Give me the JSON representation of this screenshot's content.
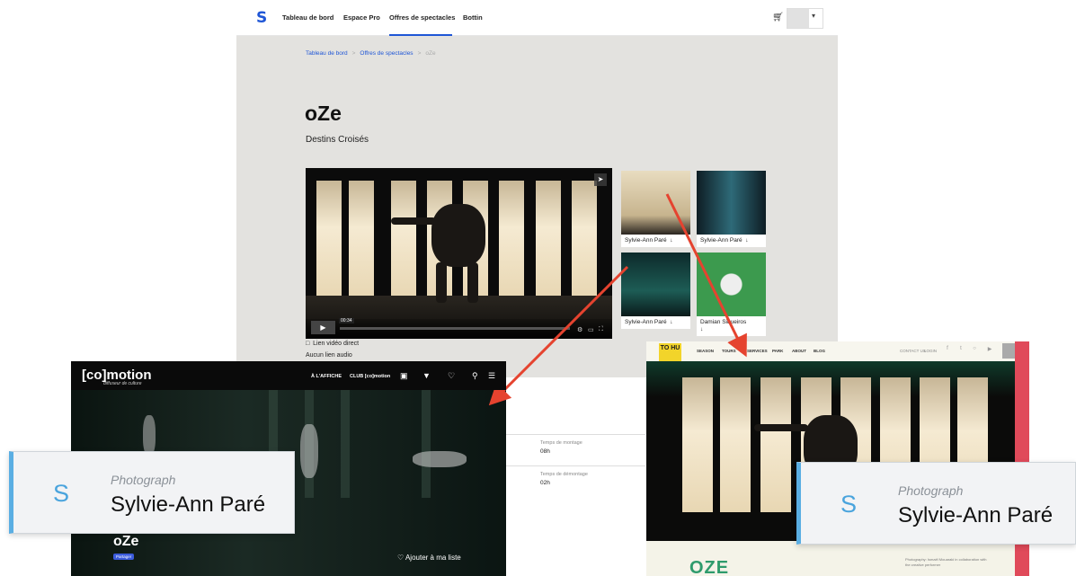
{
  "nav": {
    "logo": "S",
    "items": [
      "Tableau de bord",
      "Espace Pro",
      "Offres de spectacles",
      "Bottin"
    ],
    "active": "Offres de spectacles"
  },
  "breadcrumb": {
    "home": "Tableau de bord",
    "section": "Offres de spectacles",
    "current": "oZe"
  },
  "show": {
    "title": "oZe",
    "subtitle": "Destins Croisés"
  },
  "video": {
    "time": "00:34"
  },
  "thumbnails": [
    {
      "caption": "Sylvie-Ann Paré",
      "download": "↓"
    },
    {
      "caption": "Sylvie-Ann Paré",
      "download": "↓"
    },
    {
      "caption": "Sylvie-Ann Paré",
      "download": "↓"
    },
    {
      "caption": "Damian Siqueiros",
      "download": "↓"
    }
  ],
  "links": {
    "video": "Lien vidéo direct",
    "audio": "Aucun lien audio"
  },
  "details": {
    "montage_label": "Temps de montage",
    "montage_value": "08h",
    "demontage_label": "Temps de démontage",
    "demontage_value": "02h"
  },
  "comotion": {
    "brand": "[co]motion",
    "tagline": "diffuseur de culture",
    "menu": [
      "À L'AFFICHE",
      "CLUB [co]motion"
    ],
    "title": "oZe",
    "share": "Partager",
    "add_to_list": "Ajouter à ma liste"
  },
  "site": {
    "logo": "TO HU",
    "menu": [
      "SEASON",
      "TOURS",
      "SERVICES",
      "PARK",
      "ABOUT",
      "BLOG"
    ],
    "utility": [
      "CONTACT US",
      "LOGIN"
    ],
    "title": "OZE",
    "credit": "Photography: Ismaël Mouaraki in collaboration with the creative performer"
  },
  "callouts": [
    {
      "initial": "S",
      "role": "Photograph",
      "name": "Sylvie-Ann Paré"
    },
    {
      "initial": "S",
      "role": "Photograph",
      "name": "Sylvie-Ann Paré"
    }
  ],
  "colors": {
    "accent": "#1f56d6",
    "arrow": "#e5432f",
    "callout_accent": "#5aaee3",
    "site_green": "#2e9b6c"
  }
}
